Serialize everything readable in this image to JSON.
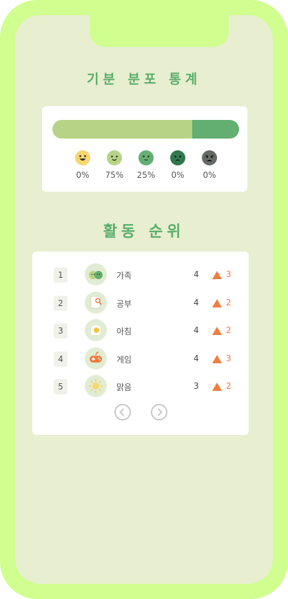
{
  "mood_section": {
    "title": "기분 분포 통계",
    "bar_segments": [
      {
        "mood": "great",
        "fraction": 0.0,
        "color": "#f5d76e"
      },
      {
        "mood": "good",
        "fraction": 0.75,
        "color": "#b7d486"
      },
      {
        "mood": "okay",
        "fraction": 0.25,
        "color": "#63ae71"
      },
      {
        "mood": "bad",
        "fraction": 0.0,
        "color": "#2f7a4c"
      },
      {
        "mood": "awful",
        "fraction": 0.0,
        "color": "#666a66"
      }
    ],
    "moods": [
      {
        "icon": "laughing-face-icon",
        "color": "#f5d76e",
        "percent": "0%"
      },
      {
        "icon": "smiling-face-icon",
        "color": "#b7d486",
        "percent": "75%"
      },
      {
        "icon": "neutral-face-icon",
        "color": "#63ae71",
        "percent": "25%"
      },
      {
        "icon": "sad-face-icon",
        "color": "#2f7a4c",
        "percent": "0%"
      },
      {
        "icon": "angry-face-icon",
        "color": "#666a66",
        "percent": "0%"
      }
    ]
  },
  "activity_section": {
    "title": "활동 순위",
    "rows": [
      {
        "rank": "1",
        "icon": "family-icon",
        "name": "가족",
        "count": "4",
        "trend": "up-triangle-icon",
        "delta": "3"
      },
      {
        "rank": "2",
        "icon": "study-icon",
        "name": "공부",
        "count": "4",
        "trend": "up-triangle-icon",
        "delta": "2"
      },
      {
        "rank": "3",
        "icon": "fried-egg-icon",
        "name": "아침",
        "count": "4",
        "trend": "up-triangle-icon",
        "delta": "2"
      },
      {
        "rank": "4",
        "icon": "gamepad-icon",
        "name": "게임",
        "count": "4",
        "trend": "up-triangle-icon",
        "delta": "3"
      },
      {
        "rank": "5",
        "icon": "sun-icon",
        "name": "맑음",
        "count": "3",
        "trend": "up-triangle-icon",
        "delta": "2"
      }
    ],
    "accent_color": "#f07c3e"
  }
}
